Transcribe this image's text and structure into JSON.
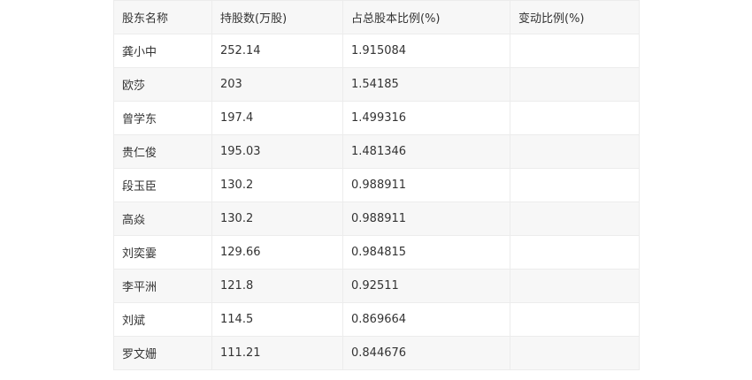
{
  "table": {
    "headers": [
      "股东名称",
      "持股数(万股)",
      "占总股本比例(%)",
      "变动比例(%)"
    ],
    "rows": [
      [
        "龚小中",
        "252.14",
        "1.915084",
        ""
      ],
      [
        "欧莎",
        "203",
        "1.54185",
        ""
      ],
      [
        "曾学东",
        "197.4",
        "1.499316",
        ""
      ],
      [
        "贵仁俊",
        "195.03",
        "1.481346",
        ""
      ],
      [
        "段玉臣",
        "130.2",
        "0.988911",
        ""
      ],
      [
        "高焱",
        "130.2",
        "0.988911",
        ""
      ],
      [
        "刘奕霎",
        "129.66",
        "0.984815",
        ""
      ],
      [
        "李平洲",
        "121.8",
        "0.92511",
        ""
      ],
      [
        "刘斌",
        "114.5",
        "0.869664",
        ""
      ],
      [
        "罗文姗",
        "111.21",
        "0.844676",
        ""
      ]
    ]
  }
}
